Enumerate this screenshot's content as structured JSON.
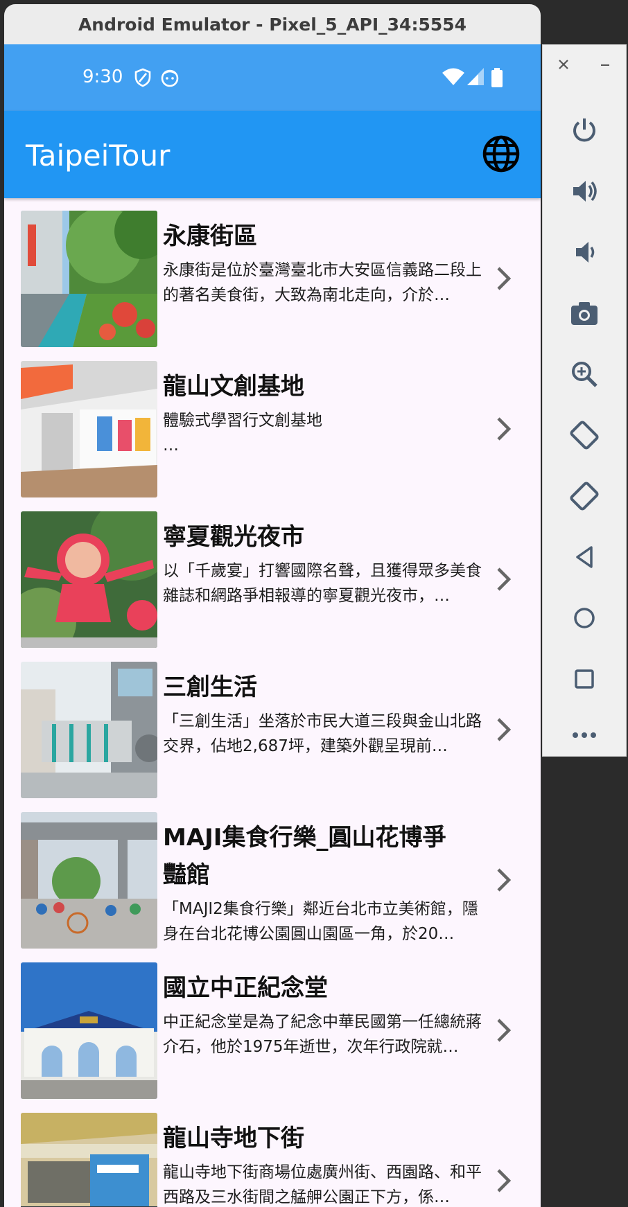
{
  "window": {
    "title": "Android Emulator - Pixel_5_API_34:5554"
  },
  "statusbar": {
    "time": "9:30"
  },
  "appbar": {
    "title": "TaipeiTour"
  },
  "colors": {
    "statusbar": "#42a0f2",
    "appbar": "#2196f3",
    "background": "#fdf6fe"
  },
  "items": [
    {
      "title": "永康街區",
      "desc": "永康街是位於臺灣臺北市大安區信義路二段上的著名美食街，大致為南北走向，介於…"
    },
    {
      "title": "龍山文創基地",
      "desc": "體驗式學習行文創基地\n…"
    },
    {
      "title": "寧夏觀光夜市",
      "desc": "以「千歲宴」打響國際名聲，且獲得眾多美食雜誌和網路爭相報導的寧夏觀光夜市，…"
    },
    {
      "title": "三創生活",
      "desc": "「三創生活」坐落於市民大道三段與金山北路交界，佔地2,687坪，建築外觀呈現前…"
    },
    {
      "title": "MAJI集食行樂_圓山花博爭豔館",
      "desc": "「MAJI2集食行樂」鄰近台北市立美術館，隱身在台北花博公園圓山園區一角，於20…"
    },
    {
      "title": "國立中正紀念堂",
      "desc": "中正紀念堂是為了紀念中華民國第一任總統蔣介石，他於1975年逝世，次年行政院就…"
    },
    {
      "title": "龍山寺地下街",
      "desc": "龍山寺地下街商場位處廣州街、西園路、和平西路及三水街間之艋舺公園正下方，係…"
    }
  ],
  "side_panel": {
    "icons": [
      "close-icon",
      "minimize-icon",
      "power-icon",
      "volume-up-icon",
      "volume-down-icon",
      "camera-icon",
      "zoom-icon",
      "rotate-left-icon",
      "rotate-right-icon",
      "back-icon",
      "home-icon",
      "overview-icon",
      "more-icon"
    ]
  }
}
